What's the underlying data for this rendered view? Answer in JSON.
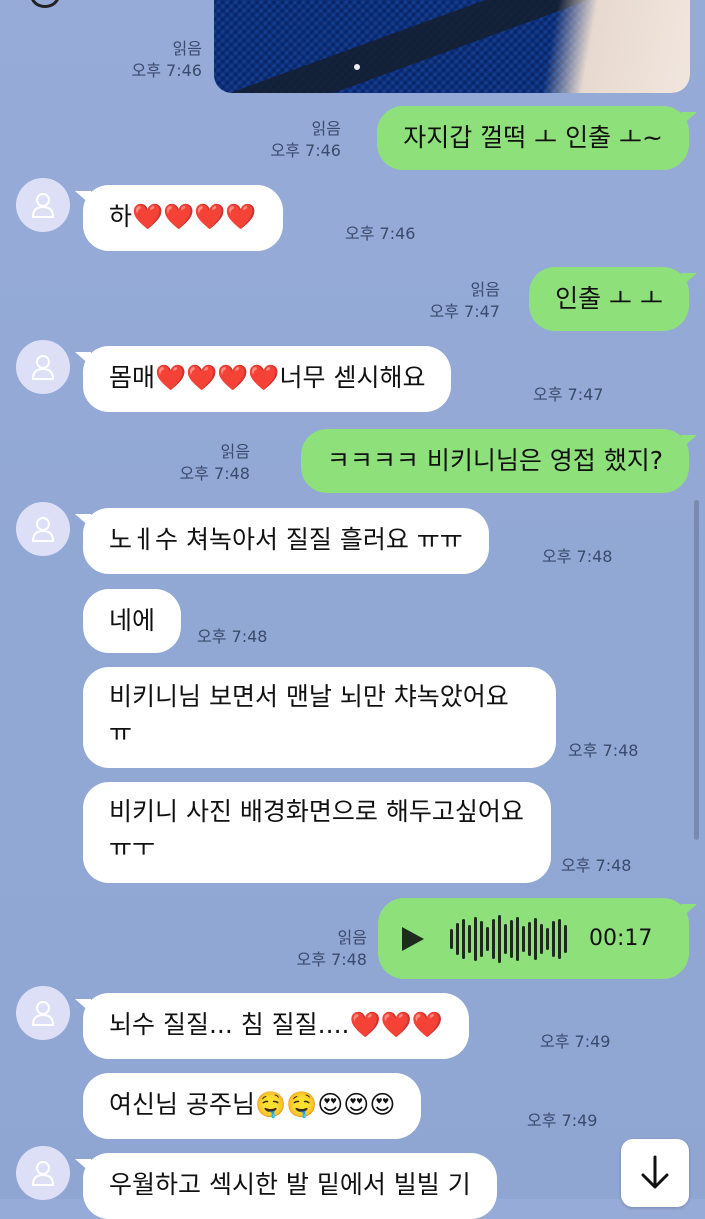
{
  "header": {
    "icons": [
      "back-icon",
      "search-icon",
      "call-icon",
      "menu-icon",
      "hamburger-icon"
    ]
  },
  "messages": [
    {
      "id": "m0",
      "side": "me",
      "type": "image",
      "read": "읽음",
      "time": "오후 7:46"
    },
    {
      "id": "m1",
      "side": "me",
      "text": "자지갑 껄떡 ㅗ 인출 ㅗ~",
      "read": "읽음",
      "time": "오후 7:46"
    },
    {
      "id": "m2",
      "side": "them",
      "text": "하❤️❤️❤️❤️",
      "time": "오후 7:46"
    },
    {
      "id": "m3",
      "side": "me",
      "text": "인출 ㅗ ㅗ",
      "read": "읽음",
      "time": "오후 7:47"
    },
    {
      "id": "m4",
      "side": "them",
      "text": "몸매❤️❤️❤️❤️너무 섿시해요",
      "time": "오후 7:47"
    },
    {
      "id": "m5",
      "side": "me",
      "text": "ㅋㅋㅋㅋ 비키니님은 영접 했지?",
      "read": "읽음",
      "time": "오후 7:48"
    },
    {
      "id": "m6",
      "side": "them",
      "text": "노ㅔ수 쳐녹아서 질질 흘러요 ㅠㅠ",
      "time": "오후 7:48"
    },
    {
      "id": "m7",
      "side": "them",
      "text": "네에",
      "time": "오후 7:48"
    },
    {
      "id": "m8",
      "side": "them",
      "text": "비키니님 보면서 맨날 뇌만 챠녹았어요 ㅠ",
      "time": "오후 7:48"
    },
    {
      "id": "m9",
      "side": "them",
      "text": "비키니 사진 배경화면으로 해두고싶어요 ㅠㅜ",
      "time": "오후 7:48"
    },
    {
      "id": "m10",
      "side": "me",
      "type": "voice",
      "duration": "00:17",
      "read": "읽음",
      "time": "오후 7:48"
    },
    {
      "id": "m11",
      "side": "them",
      "text": "뇌수 질질... 침 질질....❤️❤️❤️",
      "time": "오후 7:49"
    },
    {
      "id": "m12",
      "side": "them",
      "text": "여신님 공주님🤤🤤😍😍😍",
      "time": "오후 7:49"
    },
    {
      "id": "m13",
      "side": "them",
      "text": "우월하고 섹시한 발 밑에서 빌빌 기"
    }
  ],
  "colors": {
    "background": "#93a9d5",
    "my_bubble": "#8ee07a",
    "their_bubble": "#ffffff",
    "avatar": "#dcdff6"
  }
}
